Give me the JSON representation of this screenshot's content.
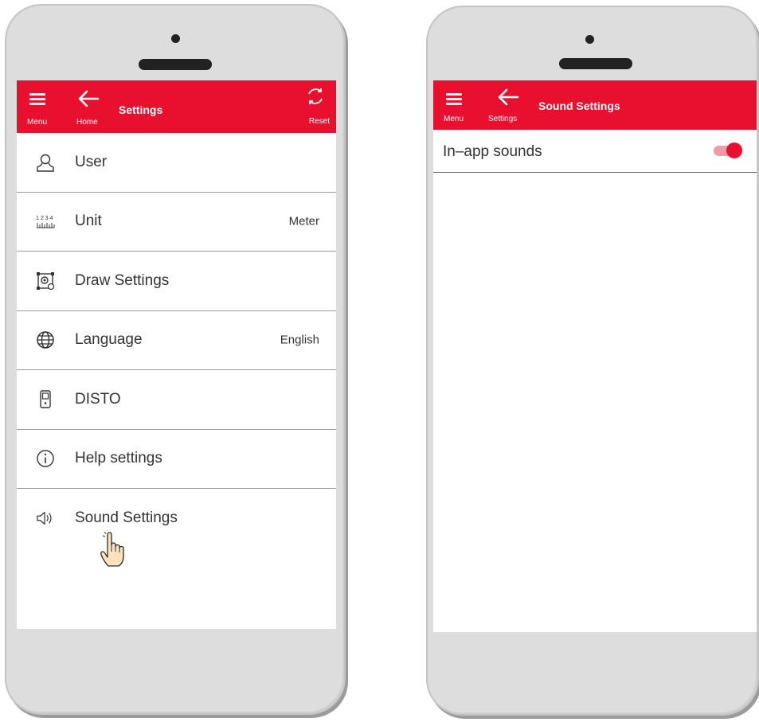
{
  "left_screen": {
    "topbar": {
      "menu_label": "Menu",
      "back_label": "Home",
      "title": "Settings",
      "reset_label": "Reset"
    },
    "items": [
      {
        "icon": "user-icon",
        "label": "User",
        "value": ""
      },
      {
        "icon": "ruler-icon",
        "label": "Unit",
        "value": "Meter",
        "icon_text": "1 2 3 4"
      },
      {
        "icon": "draw-settings-icon",
        "label": "Draw Settings",
        "value": ""
      },
      {
        "icon": "globe-icon",
        "label": "Language",
        "value": "English"
      },
      {
        "icon": "disto-device-icon",
        "label": "DISTO",
        "value": ""
      },
      {
        "icon": "info-icon",
        "label": "Help settings",
        "value": ""
      },
      {
        "icon": "speaker-icon",
        "label": "Sound Settings",
        "value": ""
      }
    ]
  },
  "right_screen": {
    "topbar": {
      "menu_label": "Menu",
      "back_label": "Settings",
      "title": "Sound Settings"
    },
    "in_app_sounds": {
      "label": "In–app sounds",
      "enabled": true
    }
  },
  "colors": {
    "brand_red": "#e8102e",
    "toggle_track": "#f29aa4",
    "phone_body": "#dddddd"
  }
}
